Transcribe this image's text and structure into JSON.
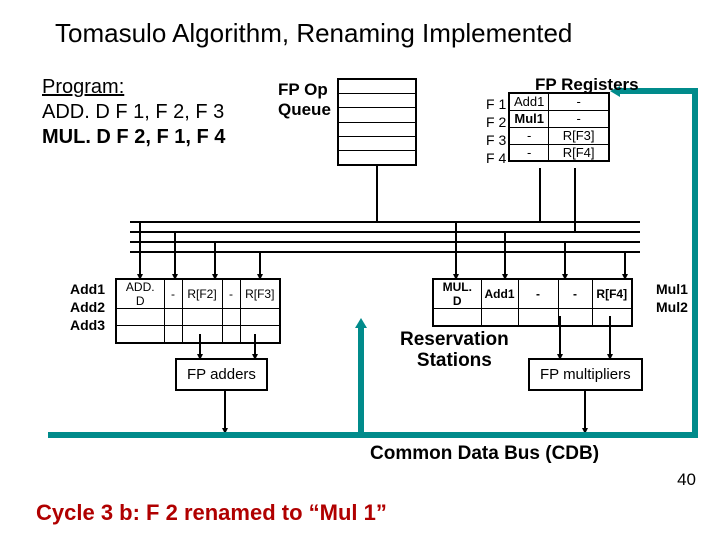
{
  "title": "Tomasulo Algorithm, Renaming Implemented",
  "program": {
    "heading": "Program:",
    "line1": "ADD. D  F 1, F 2, F 3",
    "line2": "MUL. D  F 2, F 1, F 4"
  },
  "opqueue_label1": "FP Op",
  "opqueue_label2": "Queue",
  "fpreg_title": "FP Registers",
  "fpreg_rows": {
    "r0": {
      "label": "F 1",
      "tag": "Add1",
      "val": "-"
    },
    "r1": {
      "label": "F 2",
      "tag": "Mul1",
      "val": "-"
    },
    "r2": {
      "label": "F 3",
      "tag": "-",
      "val": "R[F3]"
    },
    "r3": {
      "label": "F 4",
      "tag": "-",
      "val": "R[F4]"
    }
  },
  "add_labels": {
    "a": "Add1",
    "b": "Add2",
    "c": "Add3"
  },
  "mul_labels": {
    "a": "Mul1",
    "b": "Mul2"
  },
  "rs_add": {
    "r0": {
      "op": "ADD. D",
      "qj": "-",
      "vj": "R[F2]",
      "qk": "-",
      "vk": "R[F3]"
    }
  },
  "rs_mul": {
    "r0": {
      "op": "MUL. D",
      "qj": "Add1",
      "vj": "-",
      "qk": "-",
      "vk": "R[F4]"
    }
  },
  "fu_adders": "FP adders",
  "fu_mults": "FP multipliers",
  "rs_label1": "Reservation",
  "rs_label2": "Stations",
  "cdb": "Common Data Bus (CDB)",
  "cycle": "Cycle 3 b: F 2 renamed to “Mul 1”",
  "pagenum": "40"
}
